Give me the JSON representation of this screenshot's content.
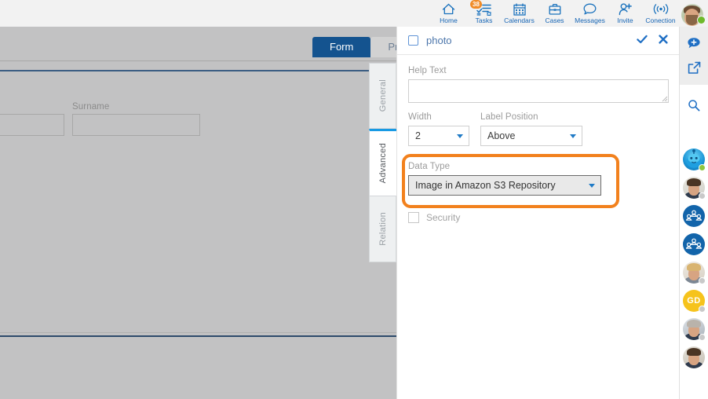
{
  "topnav": {
    "items": [
      {
        "label": "Home",
        "icon": "home-icon",
        "badge": null
      },
      {
        "label": "Tasks",
        "icon": "tasks-icon",
        "badge": "38"
      },
      {
        "label": "Calendars",
        "icon": "calendar-icon",
        "badge": null
      },
      {
        "label": "Cases",
        "icon": "briefcase-icon",
        "badge": null
      },
      {
        "label": "Messages",
        "icon": "chat-bubble-icon",
        "badge": null
      },
      {
        "label": "Invite",
        "icon": "person-add-icon",
        "badge": null
      },
      {
        "label": "Conection",
        "icon": "broadcast-icon",
        "badge": null
      }
    ],
    "avatar": {
      "name": "user-avatar",
      "status": "online"
    },
    "accent": "#1665b5",
    "badge_color": "#f08b28"
  },
  "background_app": {
    "tabs": [
      {
        "label": "Form",
        "active": true
      },
      {
        "label": "Pr",
        "active": false
      }
    ],
    "fields": [
      {
        "label": "",
        "value": ""
      },
      {
        "label": "Surname",
        "value": ""
      }
    ]
  },
  "vertical_tabs": [
    {
      "label": "General",
      "active": false
    },
    {
      "label": "Advanced",
      "active": true
    },
    {
      "label": "Relation",
      "active": false
    }
  ],
  "panel": {
    "title": "photo",
    "checkbox_checked": false,
    "confirm_icon": "checkmark-icon",
    "close_icon": "close-icon",
    "help_text": {
      "label": "Help Text",
      "value": "",
      "placeholder": ""
    },
    "width": {
      "label": "Width",
      "value": "2"
    },
    "label_position": {
      "label": "Label Position",
      "value": "Above"
    },
    "data_type": {
      "label": "Data Type",
      "value": "Image in Amazon S3 Repository"
    },
    "security": {
      "label": "Security",
      "checked": false
    },
    "highlight_color": "#f2811d"
  },
  "right_rail": {
    "buttons": [
      {
        "icon": "add-chat-icon"
      },
      {
        "icon": "external-link-icon"
      },
      {
        "icon": "search-icon"
      }
    ],
    "contacts": [
      {
        "type": "bot",
        "icon": "bot-avatar",
        "status": "online",
        "initials": ""
      },
      {
        "type": "photo",
        "icon": "contact-avatar",
        "status": "offline",
        "initials": ""
      },
      {
        "type": "group",
        "icon": "group-avatar",
        "status": "none",
        "initials": ""
      },
      {
        "type": "group",
        "icon": "group-avatar",
        "status": "none",
        "initials": ""
      },
      {
        "type": "photo",
        "icon": "contact-avatar",
        "status": "offline",
        "initials": ""
      },
      {
        "type": "initials",
        "icon": "initials-avatar",
        "status": "offline",
        "initials": "GD"
      },
      {
        "type": "photo",
        "icon": "contact-avatar",
        "status": "offline",
        "initials": ""
      },
      {
        "type": "photo",
        "icon": "contact-avatar",
        "status": "none",
        "initials": ""
      }
    ]
  }
}
